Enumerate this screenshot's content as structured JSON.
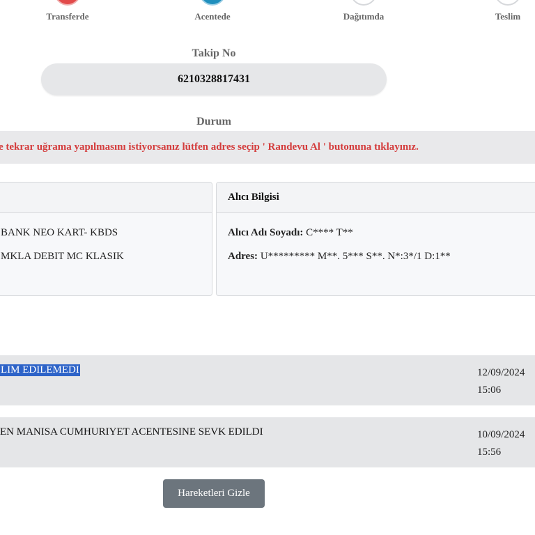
{
  "steps": [
    {
      "label": "Transferde",
      "color": "#e24a4a"
    },
    {
      "label": "Acentede",
      "color": "#1f8fbd"
    },
    {
      "label": "Dağıtımda",
      "color": "#ffffff"
    },
    {
      "label": "Teslim",
      "color": "#ffffff"
    }
  ],
  "tracking": {
    "label": "Takip No",
    "number": "6210328817431"
  },
  "status": {
    "label": "Durum",
    "warning": "e tekrar uğrama yapılmasını istiyorsanız lütfen adres seçip ' Randevu Al ' butonuna tıklayınız."
  },
  "shipment_card": {
    "line1": "BANK NEO KART- KBDS",
    "line2": "MKLA DEBIT MC KLASIK"
  },
  "recipient_card": {
    "title": "Alıcı Bilgisi",
    "name_label": "Alıcı Adı Soyadı:",
    "name_value": "C**** T**",
    "address_label": "Adres:",
    "address_value": "U********* M**. 5*** S**. N*:3*/1 D:1**"
  },
  "movements": [
    {
      "desc": "LIM EDILEMEDI",
      "date": "12/09/2024",
      "time": "15:06"
    },
    {
      "desc": "EN MANISA CUMHURIYET ACENTESINE SEVK EDILDI",
      "date": "10/09/2024",
      "time": "15:56"
    }
  ],
  "hide_button": "Hareketleri Gizle",
  "colors": {
    "warning_text": "#d43c3c",
    "button_bg": "#6c757d",
    "highlight": "#2d63c8"
  }
}
